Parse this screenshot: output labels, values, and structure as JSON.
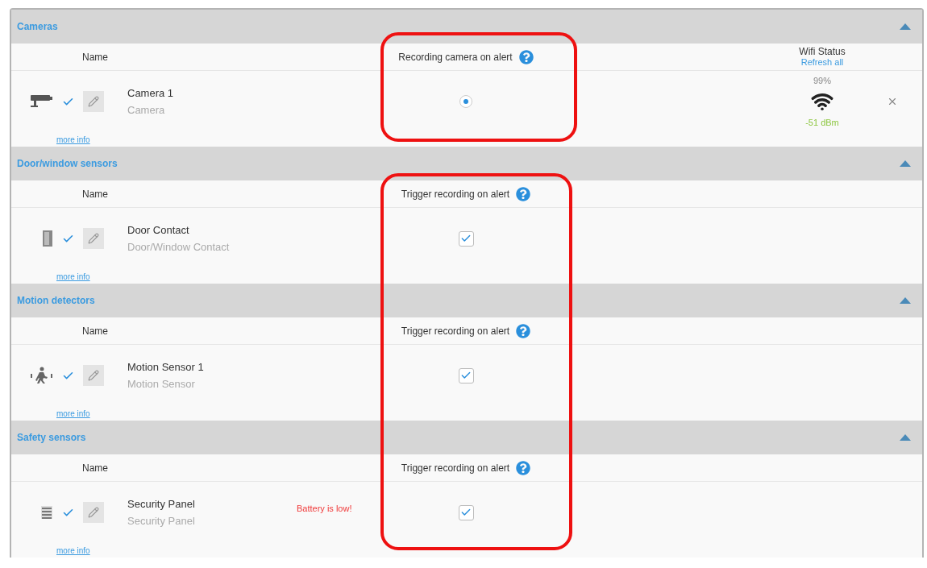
{
  "sections": [
    {
      "title": "Cameras",
      "expanded": true,
      "name_label": "Name",
      "option_label": "Recording camera on alert",
      "wifi_label": "Wifi Status",
      "refresh_label": "Refresh all",
      "devices": [
        {
          "kind": "camera",
          "active": true,
          "name": "Camera 1",
          "type": "Camera",
          "option": {
            "kind": "radio",
            "selected": true
          },
          "wifi": {
            "percent": "99%",
            "signal": "-51 dBm"
          },
          "removable": true,
          "more": "more info"
        }
      ]
    },
    {
      "title": "Door/window sensors",
      "expanded": true,
      "name_label": "Name",
      "option_label": "Trigger recording on alert",
      "devices": [
        {
          "kind": "door",
          "active": true,
          "name": "Door Contact",
          "type": "Door/Window Contact",
          "option": {
            "kind": "checkbox",
            "checked": true
          },
          "more": "more info"
        }
      ]
    },
    {
      "title": "Motion detectors",
      "expanded": true,
      "name_label": "Name",
      "option_label": "Trigger recording on alert",
      "devices": [
        {
          "kind": "motion",
          "active": true,
          "name": "Motion Sensor 1",
          "type": "Motion Sensor",
          "option": {
            "kind": "checkbox",
            "checked": true
          },
          "more": "more info"
        }
      ]
    },
    {
      "title": "Safety sensors",
      "expanded": true,
      "name_label": "Name",
      "option_label": "Trigger recording on alert",
      "devices": [
        {
          "kind": "panel",
          "active": true,
          "name": "Security Panel",
          "type": "Security Panel",
          "note": "Battery is low!",
          "option": {
            "kind": "checkbox",
            "checked": true
          },
          "more": "more info"
        }
      ]
    }
  ]
}
